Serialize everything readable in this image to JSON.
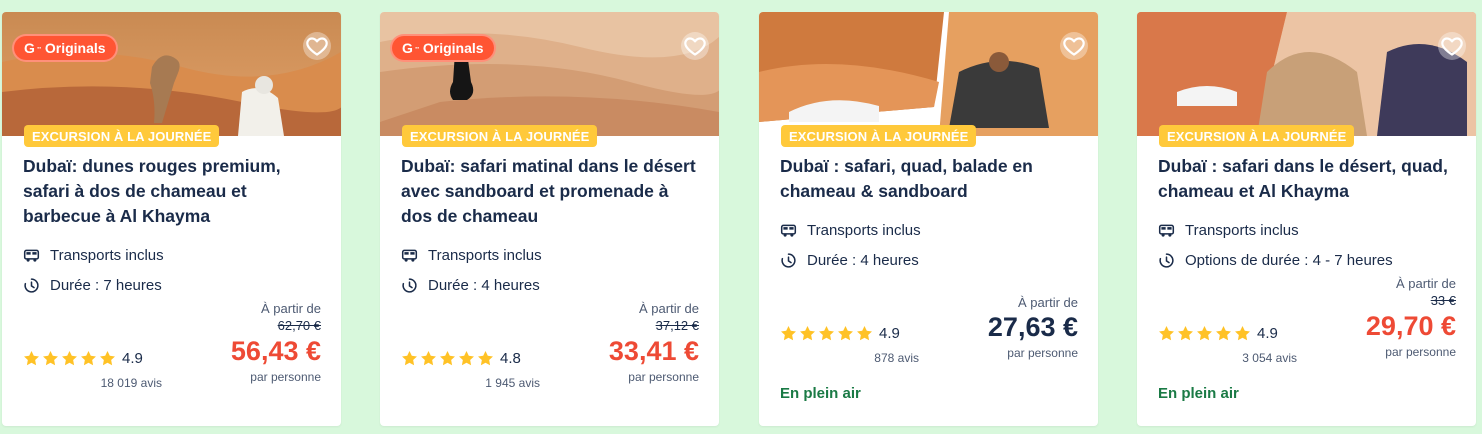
{
  "colors": {
    "page_bg": "#d8f8dc",
    "accent_price": "#ee4a35",
    "badge_orange": "#ff5533",
    "category_yellow": "#ffc93b",
    "text_dark": "#1a2b49",
    "outdoor_green": "#1a7a45",
    "star_yellow": "#ffc226"
  },
  "cards": [
    {
      "badge": {
        "g": "G",
        "dots": "··",
        "text": "Originals"
      },
      "category": "EXCURSION À LA JOURNÉE",
      "title": "Dubaï: dunes rouges premium, safari à dos de chameau et barbecue à Al Khayma",
      "features": [
        {
          "icon": "bus-icon",
          "text": "Transports inclus"
        },
        {
          "icon": "clock-icon",
          "text": "Durée : 7 heures"
        }
      ],
      "rating": "4.9",
      "reviews": "18 019 avis",
      "from": "À partir de",
      "old_price": "62,70 €",
      "price": "56,43 €",
      "per": "par personne"
    },
    {
      "badge": {
        "g": "G",
        "dots": "··",
        "text": "Originals"
      },
      "category": "EXCURSION À LA JOURNÉE",
      "title": "Dubaï: safari matinal dans le désert avec sandboard et promenade à dos de chameau",
      "features": [
        {
          "icon": "bus-icon",
          "text": "Transports inclus"
        },
        {
          "icon": "clock-icon",
          "text": "Durée : 4 heures"
        }
      ],
      "rating": "4.8",
      "reviews": "1 945 avis",
      "from": "À partir de",
      "old_price": "37,12 €",
      "price": "33,41 €",
      "per": "par personne"
    },
    {
      "category": "EXCURSION À LA JOURNÉE",
      "title": "Dubaï : safari, quad, balade en chameau & sandboard",
      "features": [
        {
          "icon": "bus-icon",
          "text": "Transports inclus"
        },
        {
          "icon": "clock-icon",
          "text": "Durée : 4 heures"
        }
      ],
      "rating": "4.9",
      "reviews": "878 avis",
      "from": "À partir de",
      "price": "27,63 €",
      "per": "par personne",
      "outdoor": "En plein air"
    },
    {
      "category": "EXCURSION À LA JOURNÉE",
      "title": "Dubaï : safari dans le désert, quad, chameau et Al Khayma",
      "features": [
        {
          "icon": "bus-icon",
          "text": "Transports inclus"
        },
        {
          "icon": "clock-icon",
          "text": "Options de durée : 4 - 7 heures"
        }
      ],
      "rating": "4.9",
      "reviews": "3 054 avis",
      "from": "À partir de",
      "old_price": "33 €",
      "price": "29,70 €",
      "per": "par personne",
      "outdoor": "En plein air"
    }
  ]
}
